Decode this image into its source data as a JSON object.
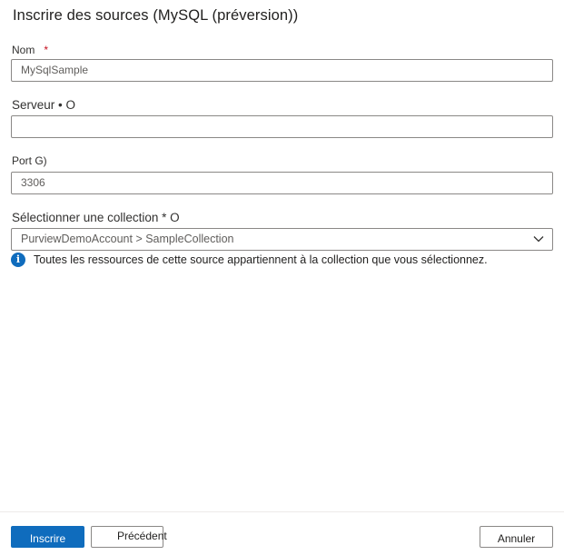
{
  "dialog": {
    "title": "Inscrire des sources (MySQL (préversion))"
  },
  "form": {
    "name_label": "Nom",
    "name_required_mark": "*",
    "name_value": "MySqlSample",
    "server_label": "Serveur • O",
    "server_value": "",
    "port_label": "Port G)",
    "port_value": "3306",
    "collection_label": "Sélectionner une collection * O",
    "collection_value": "PurviewDemoAccount > SampleCollection",
    "collection_info": "Toutes les ressources de cette source appartiennent à la collection que vous sélectionnez.",
    "info_icon": "i"
  },
  "footer": {
    "register_label": "Inscrire",
    "previous_label": "Précédent",
    "cancel_label": "Annuler"
  },
  "colors": {
    "accent": "#0f6cbd",
    "required": "#c50f1f"
  }
}
